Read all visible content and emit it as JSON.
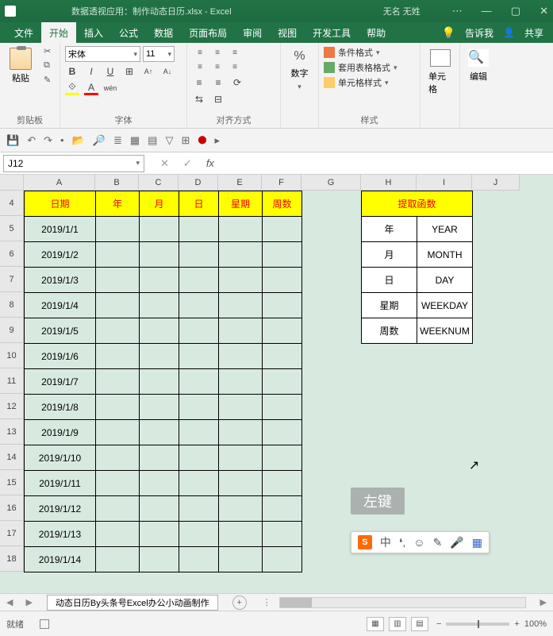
{
  "titlebar": {
    "title": "数据透视应用：制作动态日历.xlsx - Excel",
    "user": "无名 无姓",
    "win_min": "—",
    "win_max": "▢",
    "win_close": "✕",
    "menu_icon": "⋯"
  },
  "tabs": {
    "items": [
      "文件",
      "开始",
      "插入",
      "公式",
      "数据",
      "页面布局",
      "审阅",
      "视图",
      "开发工具",
      "帮助"
    ],
    "active_index": 1,
    "tell_me": "告诉我",
    "share": "共享",
    "bulb": "💡",
    "share_icon": "👤"
  },
  "ribbon": {
    "groups": {
      "clipboard": {
        "label": "剪贴板",
        "paste": "粘贴",
        "cut": "✂",
        "copy": "⧉",
        "fmt": "✎"
      },
      "font": {
        "label": "字体",
        "name": "宋体",
        "size": "11",
        "bold": "B",
        "italic": "I",
        "underline": "U",
        "border": "⊞",
        "sup": "A↑",
        "sub": "A↓",
        "fill": "⟐",
        "color": "A",
        "wen": "wén",
        "dd": "▾"
      },
      "align": {
        "label": "对齐方式",
        "wrap": "⇆",
        "merge": "⊟",
        "indent_l": "≡",
        "indent_r": "≡"
      },
      "number": {
        "label": "数字",
        "fmt": "%",
        "dd": "▾"
      },
      "styles": {
        "label": "样式",
        "cond": "条件格式",
        "tbl": "套用表格格式",
        "cell": "单元格样式",
        "dd": "▾"
      },
      "cells": {
        "label": "单元格"
      },
      "edit": {
        "label": "编辑"
      }
    }
  },
  "qat": {
    "save": "💾",
    "undo": "↶",
    "redo": "↷",
    "sep": "•",
    "open": "📂",
    "zoom": "🔎",
    "bullets": "≣",
    "task": "▦",
    "tbl": "▤",
    "filter": "▽",
    "pt": "⊞",
    "rec": "⬤",
    "play": "▸"
  },
  "fxbar": {
    "namebox": "J12",
    "cancel": "✕",
    "enter": "✓",
    "fx": "fx",
    "formula": ""
  },
  "grid": {
    "cols": [
      "A",
      "B",
      "C",
      "D",
      "E",
      "F",
      "G",
      "H",
      "I",
      "J"
    ],
    "row_start": 4,
    "row_end": 18,
    "main_headers": [
      "日期",
      "年",
      "月",
      "日",
      "星期",
      "周数"
    ],
    "dates": [
      "2019/1/1",
      "2019/1/2",
      "2019/1/3",
      "2019/1/4",
      "2019/1/5",
      "2019/1/6",
      "2019/1/7",
      "2019/1/8",
      "2019/1/9",
      "2019/1/10",
      "2019/1/11",
      "2019/1/12",
      "2019/1/13",
      "2019/1/14"
    ],
    "func_header": "提取函数",
    "func_rows": [
      {
        "label": "年",
        "fn": "YEAR"
      },
      {
        "label": "月",
        "fn": "MONTH"
      },
      {
        "label": "日",
        "fn": "DAY"
      },
      {
        "label": "星期",
        "fn": "WEEKDAY"
      },
      {
        "label": "周数",
        "fn": "WEEKNUM"
      }
    ]
  },
  "overlay": {
    "cursor": "↖",
    "lmb": "左键"
  },
  "ime": {
    "logo": "S",
    "cn": "中",
    "punct": "❛,",
    "emoji": "☺",
    "edit": "✎",
    "mic": "🎤",
    "grid": "▦"
  },
  "sheettabs": {
    "prev": "◀",
    "next": "▶",
    "active": "动态日历By头条号Excel办公小动画制作",
    "add": "+"
  },
  "status": {
    "ready": "就绪",
    "rec": "▢",
    "v1": "▦",
    "v2": "▥",
    "v3": "▤",
    "minus": "−",
    "plus": "+",
    "zoom": "100%"
  }
}
